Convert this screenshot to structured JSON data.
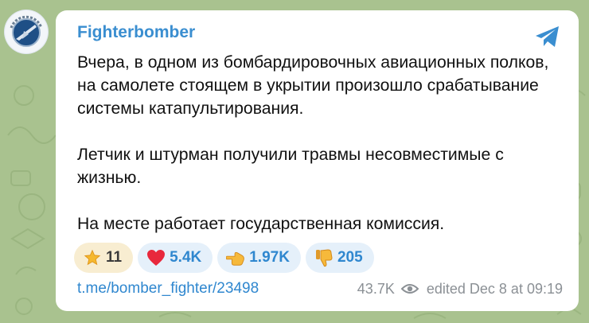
{
  "post": {
    "channel_name": "Fighterbomber",
    "paragraphs": [
      "Вчера, в одном из бомбардировочных авиационных полков, на самолете стоящем в укрытии произошло срабатывание системы катапультирования.",
      "Летчик и штурман получили травмы несовместимые с жизнью.",
      "На месте работает государственная комиссия."
    ],
    "reactions": [
      {
        "icon": "star-icon",
        "count": "11"
      },
      {
        "icon": "heart-icon",
        "count": "5.4K"
      },
      {
        "icon": "pointing-hand-icon",
        "count": "1.97K"
      },
      {
        "icon": "thumbs-down-icon",
        "count": "205"
      }
    ],
    "link": "t.me/bomber_fighter/23498",
    "views": "43.7K",
    "edited_label": "edited",
    "date": "Dec 8 at 09:19"
  },
  "colors": {
    "accent": "#3a8ed0",
    "reaction_bg": "#e5f0fa",
    "paid_reaction_bg": "#f8edd1",
    "chat_bg": "#a9c28f"
  }
}
